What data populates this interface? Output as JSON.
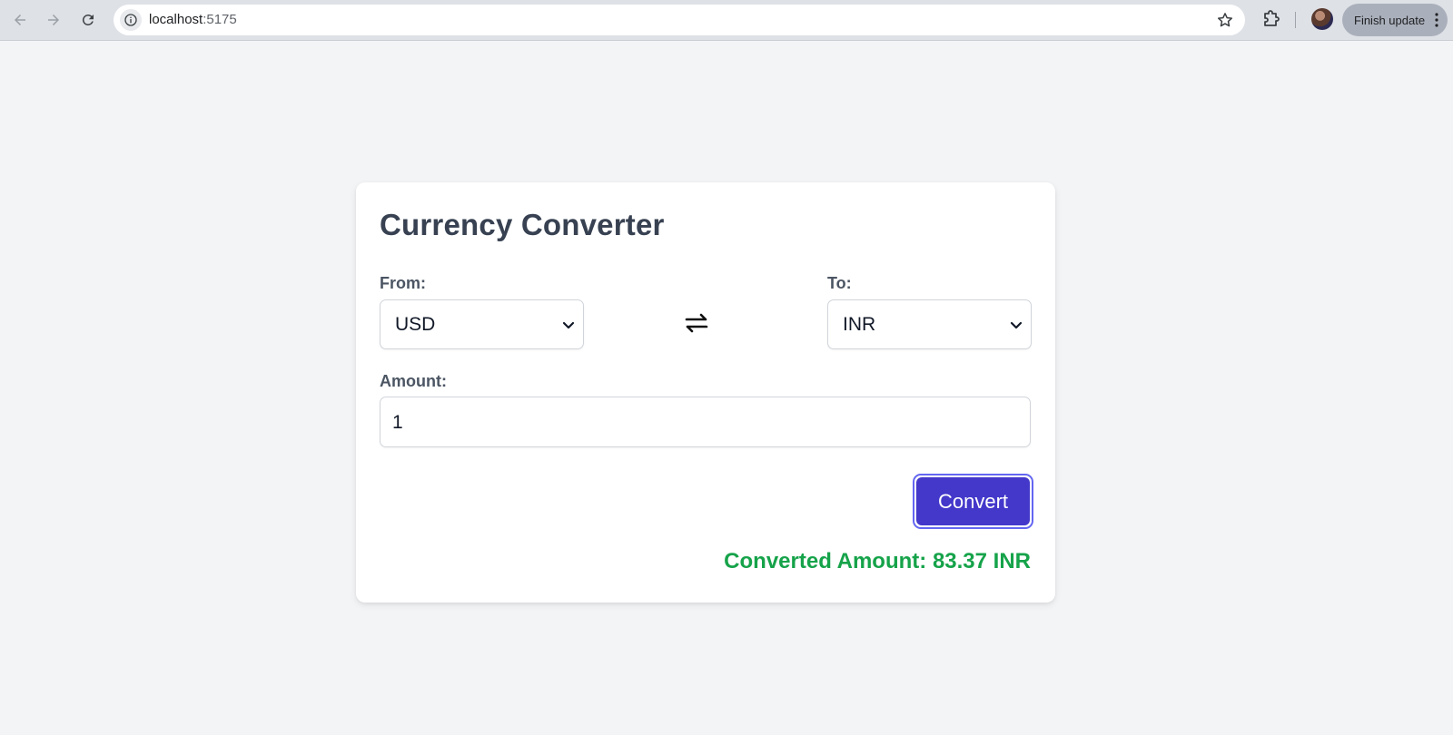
{
  "browser": {
    "url_host": "localhost",
    "url_port": ":5175",
    "update_label": "Finish update"
  },
  "card": {
    "title": "Currency Converter",
    "from_label": "From:",
    "from_value": "USD",
    "to_label": "To:",
    "to_value": "INR",
    "amount_label": "Amount:",
    "amount_value": "1",
    "convert_label": "Convert",
    "result_text": "Converted Amount: 83.37 INR"
  },
  "colors": {
    "page_bg": "#f3f4f6",
    "button_bg": "#4338ca",
    "button_ring": "#6366f1",
    "result": "#16a34a",
    "title": "#374151"
  }
}
